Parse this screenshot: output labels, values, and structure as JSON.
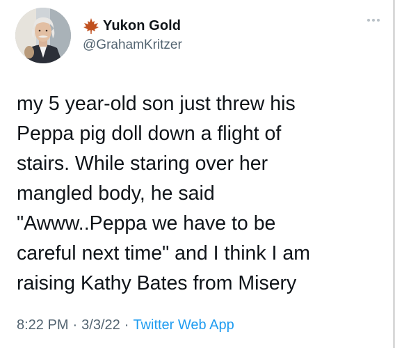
{
  "tweet": {
    "display_name": "Yukon Gold",
    "handle": "@GrahamKritzer",
    "badge_icon": "maple-leaf-icon",
    "more_icon": "more-horizontal-icon",
    "text": "my 5 year-old son just threw his\nPeppa pig doll down a flight of\nstairs. While staring over her\nmangled body, he said\n\"Awww..Peppa we have to be\ncareful next time\" and I think I am\nraising Kathy Bates from Misery",
    "time": "8:22 PM",
    "separator": "·",
    "date": "3/3/22",
    "source": "Twitter Web App"
  },
  "colors": {
    "text_primary": "#0f1419",
    "text_secondary": "#536471",
    "link": "#1d9bf0",
    "maple_leaf": "#c0501f"
  }
}
